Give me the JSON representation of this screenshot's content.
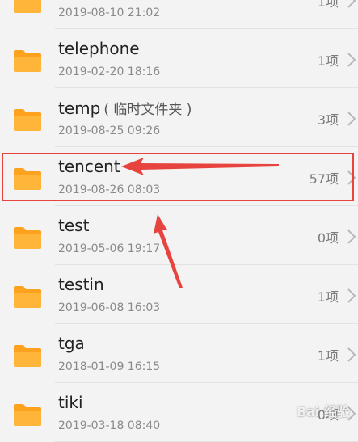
{
  "icons": {
    "folder": "folder-icon",
    "chevron": "chevron-right-icon"
  },
  "colors": {
    "folder": "#FCA21E",
    "highlight": "#E8443F",
    "background": "#F3F3F3"
  },
  "files": [
    {
      "name": "",
      "note": "",
      "date": "2019-08-10 21:02",
      "count": "1项"
    },
    {
      "name": "telephone",
      "note": "",
      "date": "2019-02-20 18:16",
      "count": "1项"
    },
    {
      "name": "temp",
      "note": "( 临时文件夹 )",
      "date": "2019-08-25 09:26",
      "count": "3项"
    },
    {
      "name": "tencent",
      "note": "",
      "date": "2019-08-26 08:03",
      "count": "57项"
    },
    {
      "name": "test",
      "note": "",
      "date": "2019-05-06 19:17",
      "count": "0项"
    },
    {
      "name": "testin",
      "note": "",
      "date": "2019-06-08 16:03",
      "count": "1项"
    },
    {
      "name": "tga",
      "note": "",
      "date": "2018-01-09 16:15",
      "count": "1项"
    },
    {
      "name": "tiki",
      "note": "",
      "date": "2019-03-18 08:40",
      "count": "0项"
    }
  ],
  "watermark": "Bai 经验"
}
